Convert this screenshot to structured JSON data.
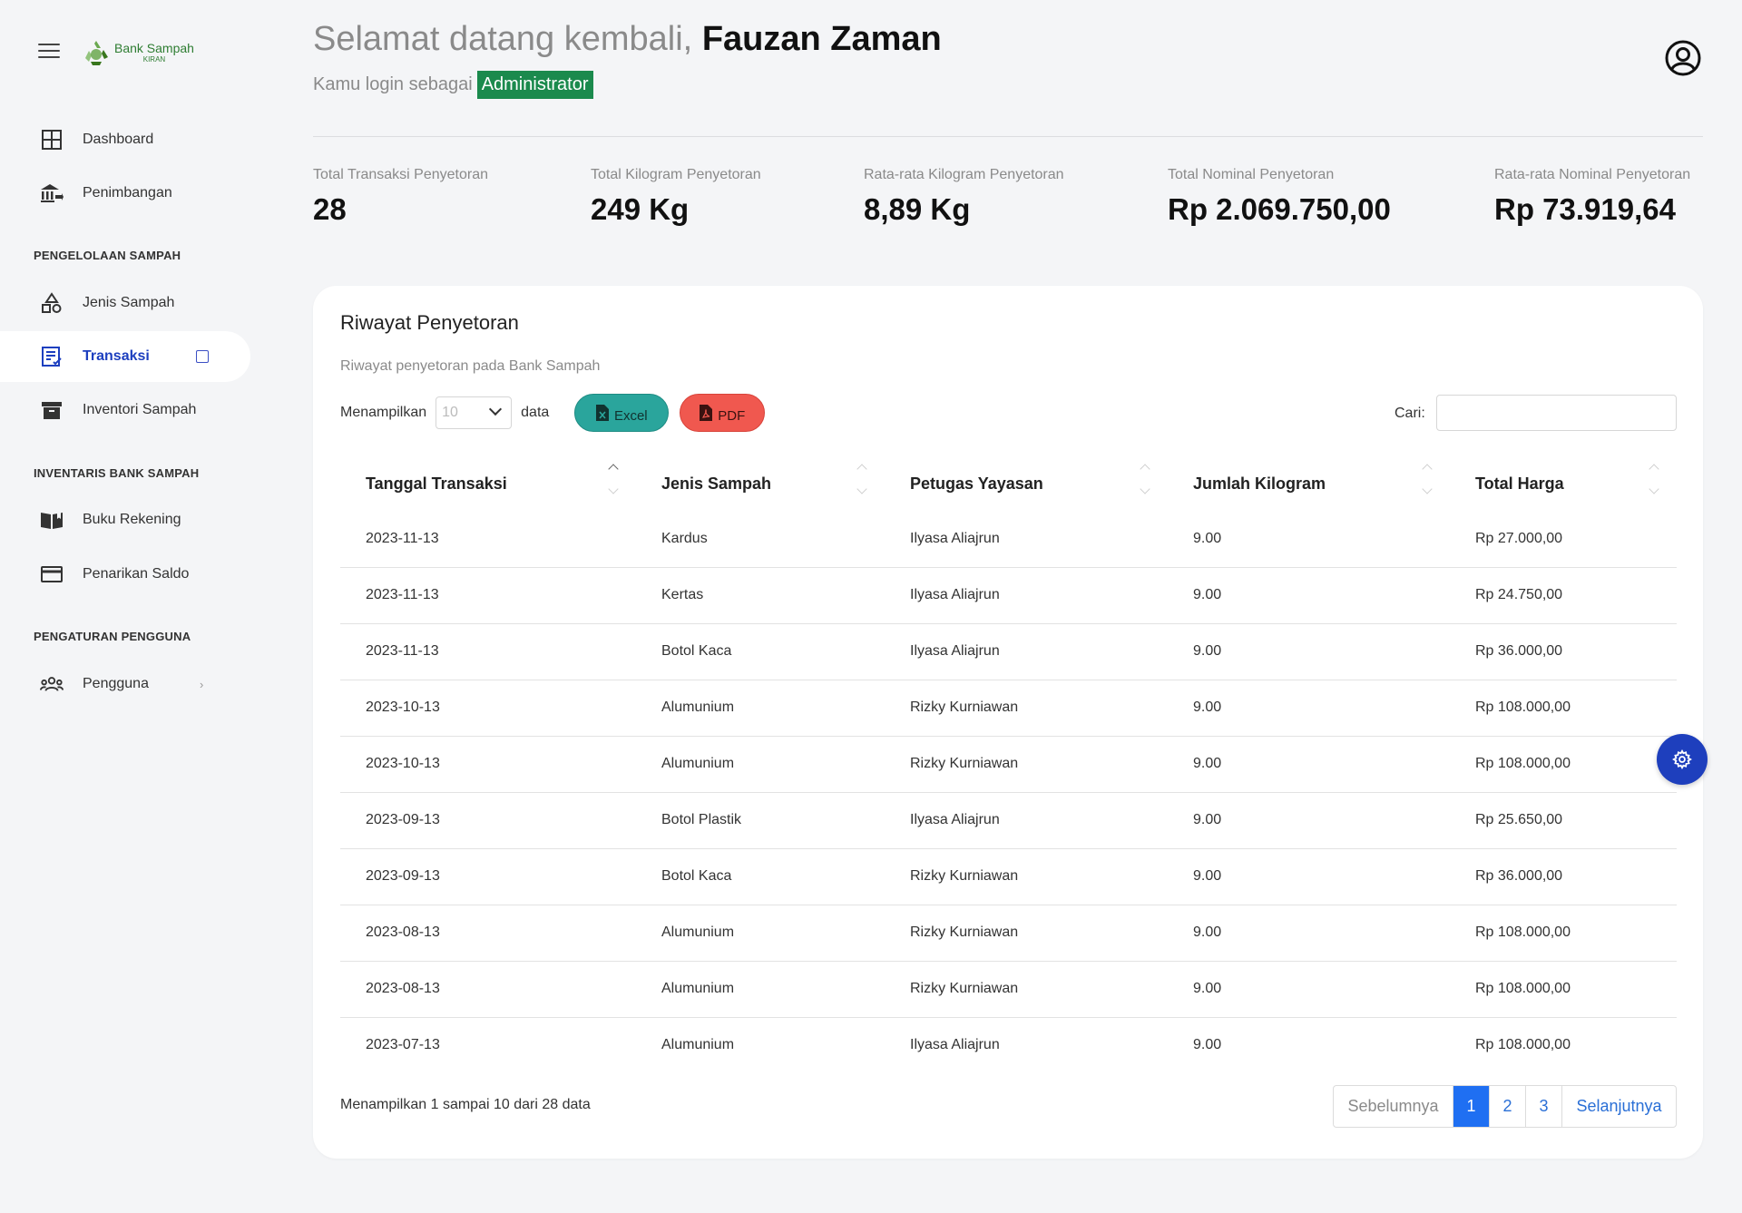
{
  "brand": {
    "title": "Bank Sampah",
    "subtitle": "KIRAN"
  },
  "sidebar": {
    "items": [
      {
        "label": "Dashboard",
        "icon": "grid-icon"
      },
      {
        "label": "Penimbangan",
        "icon": "bank-icon"
      }
    ],
    "section1": "PENGELOLAAN SAMPAH",
    "items1": [
      {
        "label": "Jenis Sampah",
        "icon": "shapes-icon"
      },
      {
        "label": "Transaksi",
        "icon": "receipt-icon"
      },
      {
        "label": "Inventori Sampah",
        "icon": "archive-icon"
      }
    ],
    "section2": "INVENTARIS BANK SAMPAH",
    "items2": [
      {
        "label": "Buku Rekening",
        "icon": "book-icon"
      },
      {
        "label": "Penarikan Saldo",
        "icon": "card-icon"
      }
    ],
    "section3": "PENGATURAN PENGGUNA",
    "items3": [
      {
        "label": "Pengguna",
        "icon": "users-icon"
      }
    ]
  },
  "header": {
    "welcome_prefix": "Selamat datang kembali,",
    "user_name": "Fauzan Zaman",
    "login_prefix": "Kamu login sebagai",
    "role": "Administrator"
  },
  "stats": [
    {
      "label": "Total Transaksi Penyetoran",
      "value": "28"
    },
    {
      "label": "Total Kilogram Penyetoran",
      "value": "249 Kg"
    },
    {
      "label": "Rata-rata Kilogram Penyetoran",
      "value": "8,89 Kg"
    },
    {
      "label": "Total Nominal Penyetoran",
      "value": "Rp 2.069.750,00"
    },
    {
      "label": "Rata-rata Nominal Penyetoran",
      "value": "Rp 73.919,64"
    }
  ],
  "card": {
    "title": "Riwayat Penyetoran",
    "subtitle": "Riwayat penyetoran pada Bank Sampah",
    "show_prefix": "Menampilkan",
    "page_size": "10",
    "show_suffix": "data",
    "excel_label": "Excel",
    "pdf_label": "PDF",
    "search_label": "Cari:",
    "search_value": ""
  },
  "table": {
    "columns": [
      "Tanggal Transaksi",
      "Jenis Sampah",
      "Petugas Yayasan",
      "Jumlah Kilogram",
      "Total Harga"
    ],
    "rows": [
      [
        "2023-11-13",
        "Kardus",
        "Ilyasa Aliajrun",
        "9.00",
        "Rp 27.000,00"
      ],
      [
        "2023-11-13",
        "Kertas",
        "Ilyasa Aliajrun",
        "9.00",
        "Rp 24.750,00"
      ],
      [
        "2023-11-13",
        "Botol Kaca",
        "Ilyasa Aliajrun",
        "9.00",
        "Rp 36.000,00"
      ],
      [
        "2023-10-13",
        "Alumunium",
        "Rizky Kurniawan",
        "9.00",
        "Rp 108.000,00"
      ],
      [
        "2023-10-13",
        "Alumunium",
        "Rizky Kurniawan",
        "9.00",
        "Rp 108.000,00"
      ],
      [
        "2023-09-13",
        "Botol Plastik",
        "Ilyasa Aliajrun",
        "9.00",
        "Rp 25.650,00"
      ],
      [
        "2023-09-13",
        "Botol Kaca",
        "Rizky Kurniawan",
        "9.00",
        "Rp 36.000,00"
      ],
      [
        "2023-08-13",
        "Alumunium",
        "Rizky Kurniawan",
        "9.00",
        "Rp 108.000,00"
      ],
      [
        "2023-08-13",
        "Alumunium",
        "Rizky Kurniawan",
        "9.00",
        "Rp 108.000,00"
      ],
      [
        "2023-07-13",
        "Alumunium",
        "Ilyasa Aliajrun",
        "9.00",
        "Rp 108.000,00"
      ]
    ]
  },
  "footer": {
    "info": "Menampilkan 1 sampai 10 dari 28 data",
    "prev": "Sebelumnya",
    "pages": [
      "1",
      "2",
      "3"
    ],
    "next": "Selanjutnya"
  },
  "colors": {
    "accent": "#1d3fbf",
    "role_badge": "#1b8a4d",
    "excel": "#2aa59c",
    "pdf": "#f0584f",
    "page_active": "#1f6ff2"
  }
}
